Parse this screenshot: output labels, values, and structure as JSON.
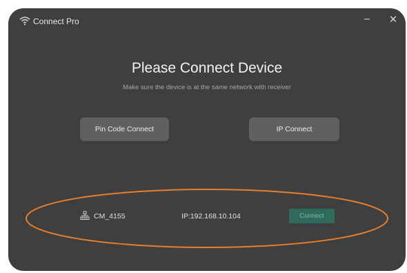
{
  "window": {
    "title": "Connect Pro",
    "minimize_label": "−",
    "close_label": "✕"
  },
  "main": {
    "heading": "Please Connect Device",
    "subheading": "Make sure the device is at the same network with receiver",
    "pin_button": "Pin Code Connect",
    "ip_button": "IP Connect"
  },
  "devices": [
    {
      "name": "CM_4155",
      "ip": "IP:192.168.10.104",
      "action": "Connect"
    }
  ],
  "colors": {
    "window_bg": "#3f3f3f",
    "button_bg": "#606060",
    "connect_bg": "#2f6b5d",
    "highlight": "#e67e2e"
  },
  "icons": {
    "app": "wifi-icon",
    "device": "network-device-icon"
  }
}
